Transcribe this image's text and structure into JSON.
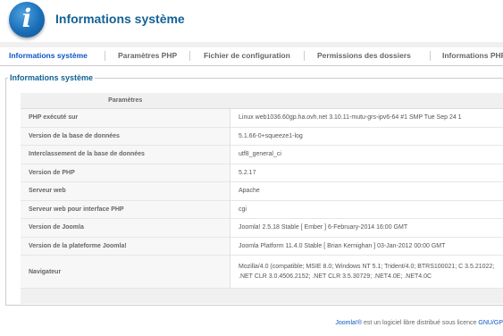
{
  "header": {
    "title": "Informations système",
    "logo_icon": "info-icon"
  },
  "tabs": [
    {
      "label": "Informations système",
      "active": true
    },
    {
      "label": "Paramètres PHP",
      "active": false
    },
    {
      "label": "Fichier de configuration",
      "active": false
    },
    {
      "label": "Permissions des dossiers",
      "active": false
    },
    {
      "label": "Informations PHP",
      "active": false
    }
  ],
  "section": {
    "legend": "Informations système",
    "column_header": "Paramètres"
  },
  "rows": [
    {
      "key": "PHP exécuté sur",
      "value": "Linux web1036.60gp.ha.ovh.net 3.10.11-mutu-grs-ipv6-64 #1 SMP Tue Sep 24 1"
    },
    {
      "key": "Version de la base de données",
      "value": "5.1.66-0+squeeze1-log"
    },
    {
      "key": "Interclassement de la base de données",
      "value": "utf8_general_ci"
    },
    {
      "key": "Version de PHP",
      "value": "5.2.17"
    },
    {
      "key": "Serveur web",
      "value": "Apache"
    },
    {
      "key": "Serveur web pour interface PHP",
      "value": "cgi"
    },
    {
      "key": "Version de Joomla",
      "value": "Joomla! 2.5.18 Stable [ Ember ] 6-February-2014 16:00 GMT"
    },
    {
      "key": "Version de la plateforme Joomla!",
      "value": "Joomla Platform 11.4.0 Stable [ Brian Kernighan ] 03-Jan-2012 00:00 GMT"
    },
    {
      "key": "Navigateur",
      "value": "Mozilla/4.0 (compatible; MSIE 8.0; Windows NT 5.1; Trident/4.0; BTRS100021; C 3.5.21022; .NET CLR 3.0.4506.2152; .NET CLR 3.5.30729; .NET4.0E; .NET4.0C"
    }
  ],
  "footer": {
    "joomla_link": "Joomla!®",
    "text": " est un logiciel libre distribué sous licence ",
    "license_link": "GNU/GP"
  }
}
